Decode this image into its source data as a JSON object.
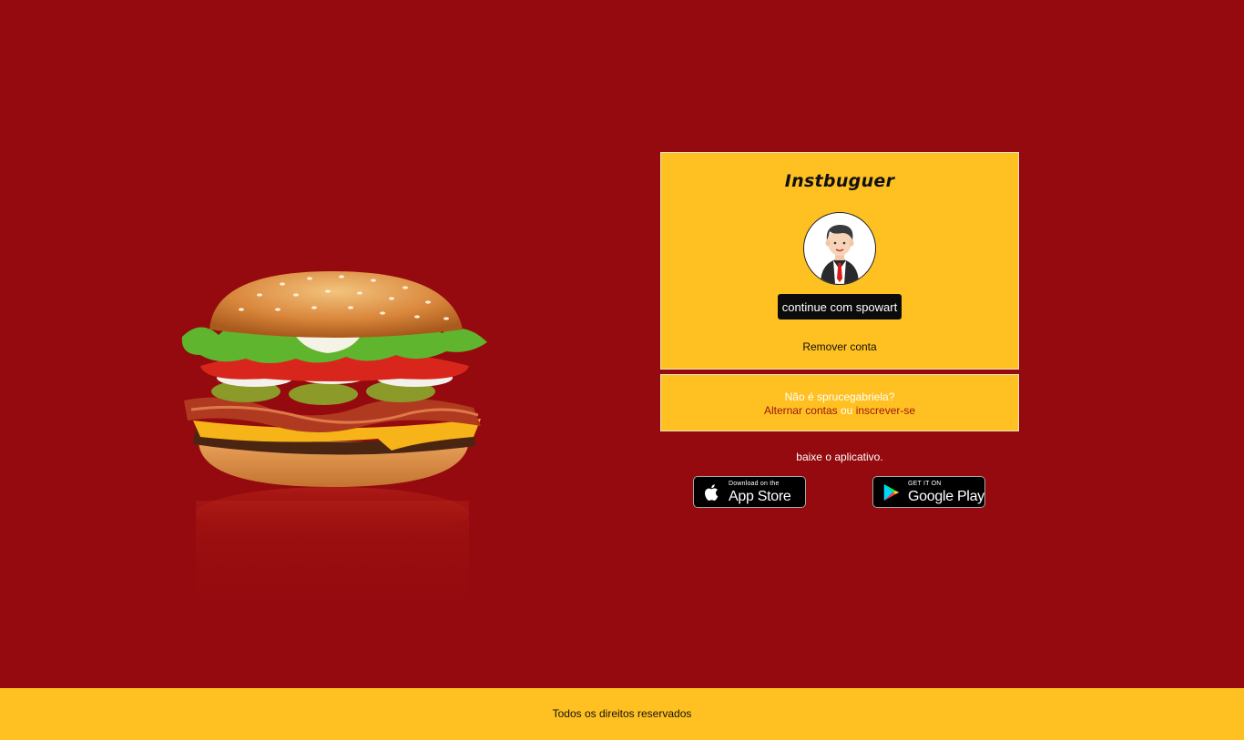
{
  "brand": {
    "name": "Instbuguer"
  },
  "account_card": {
    "continue_label": "continue com spowart",
    "remove_label": "Remover conta"
  },
  "switch_card": {
    "question": "Não é sprucegabriela?",
    "switch_label": "Alternar contas",
    "or_label": "ou",
    "signup_label": "inscrever-se"
  },
  "get_app": {
    "label": "baixe o aplicativo."
  },
  "badges": {
    "appstore_small": "Download on the",
    "appstore_big": "App Store",
    "gplay_small": "GET IT ON",
    "gplay_big": "Google Play"
  },
  "footer": {
    "text": "Todos os direitos reservados"
  },
  "colors": {
    "background": "#940a0e",
    "accent": "#ffc121",
    "button": "#0b0b0b",
    "link": "#9a1414"
  },
  "icons": {
    "avatar": "user-avatar-icon",
    "apple": "apple-icon",
    "play": "google-play-icon"
  }
}
